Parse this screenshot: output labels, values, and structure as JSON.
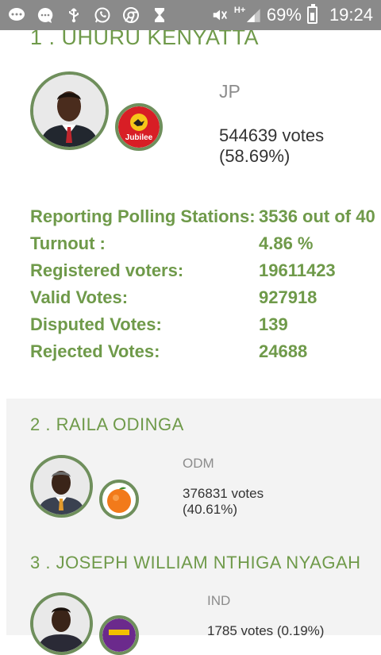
{
  "status_bar": {
    "icons": [
      "chat-icon",
      "message-icon",
      "usb-icon",
      "whatsapp-icon",
      "chrome-icon",
      "hourglass-icon"
    ],
    "network_label": "H+",
    "battery_percent": "69%",
    "time": "19:24"
  },
  "candidates": [
    {
      "title": "1 . UHURU KENYATTA",
      "party": "JP",
      "votes_line1": "544639 votes",
      "votes_line2": "(58.69%)",
      "logo_text": "Jubilee",
      "logo_colors": [
        "#d81e25",
        "#f6c619"
      ]
    },
    {
      "title": "2 . RAILA ODINGA",
      "party": "ODM",
      "votes_line1": "376831 votes",
      "votes_line2": "(40.61%)",
      "logo_colors": [
        "#f27a1a"
      ]
    },
    {
      "title": "3 . JOSEPH WILLIAM NTHIGA NYAGAH",
      "party": "IND",
      "votes_line1": "1785 votes (0.19%)",
      "logo_colors": [
        "#6b2a8c",
        "#f2c000"
      ]
    }
  ],
  "stats": [
    {
      "label": "Reporting Polling Stations:",
      "value": "3536 out of 40"
    },
    {
      "label": "Turnout :",
      "value": "4.86 %"
    },
    {
      "label": "Registered voters:",
      "value": "19611423"
    },
    {
      "label": "Valid Votes:",
      "value": "927918"
    },
    {
      "label": "Disputed Votes:",
      "value": "139"
    },
    {
      "label": "Rejected Votes:",
      "value": "24688"
    }
  ],
  "colors": {
    "accent_green": "#6f9a4a",
    "ring_green": "#6f8f5c",
    "status_bar_bg": "#8a8a8a",
    "panel_gray": "#f3f3f3"
  }
}
